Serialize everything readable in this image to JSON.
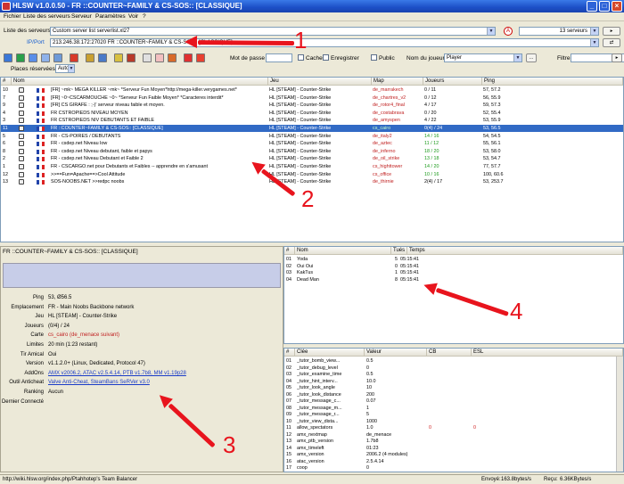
{
  "window": {
    "title": "HLSW v1.0.0.50 - FR ::COUNTER~FAMILY & CS-SOS:: [CLASSIQUE]"
  },
  "menu": [
    "Fichier",
    "Liste des serveurs",
    "Serveur",
    "Paramètres",
    "Voir",
    "?"
  ],
  "serverlist": {
    "label": "Liste des serveurs",
    "value": "Custom server list       serverlist.xl27",
    "count": "13 serveurs"
  },
  "ipport": {
    "label": "IP/Port",
    "value": "213.246.38.172:27020 FR ::COUNTER~FAMILY & CS-SOS:: [CLASSIQUE]"
  },
  "toolbar": {
    "password_label": "Mot de passe",
    "hide_label": "Cacher",
    "save_label": "Enregistrer",
    "public_label": "Public",
    "player_label": "Nom du joueur",
    "player_value": "Player",
    "filter_label": "Filtre",
    "reserved_label": "Places réservées",
    "reserved_value": "Auto"
  },
  "table": {
    "headers": [
      "#",
      "Nom",
      "Jeu",
      "Map",
      "Joueurs",
      "Ping"
    ],
    "rows": [
      {
        "n": "10",
        "name": "[FR] ~mk~ MEGA KILLER ~mk~ *Serveur Fun Moyen*http://mega-killer.verygames.net*",
        "game": "HL [STEAM] - Counter-Strike",
        "map": "de_marrakech",
        "players": "0 / 11",
        "ping": "57, 57.2"
      },
      {
        "n": "7",
        "name": "[FR] ~0~CSCARMOUCHE ~0~ *Serveur Fun Faible Moyen* *Caracteres interdit*",
        "game": "HL [STEAM] - Counter-Strike",
        "map": "de_chartres_v2",
        "players": "0 / 12",
        "ping": "56, 55.9"
      },
      {
        "n": "9",
        "name": "[FR] CS GIRAFE : ;-)' serveur niveau faible et moyen.",
        "game": "HL [STEAM] - Counter-Strike",
        "map": "de_rotor4_final",
        "players": "4 / 17",
        "ping": "59, 57.3"
      },
      {
        "n": "4",
        "name": "FR CSTROPIEDS NIVEAU MOYEN",
        "game": "HL [STEAM] - Counter-Strike",
        "map": "de_costabrava",
        "players": "0 / 20",
        "ping": "52, 55.4"
      },
      {
        "n": "3",
        "name": "FR CSTROPIEDS NIV DEBUTANTS ET FAIBLE",
        "game": "HL [STEAM] - Counter-Strike",
        "map": "de_amyspen",
        "players": "4 / 22",
        "ping": "53, 55.9"
      },
      {
        "n": "11",
        "name": "FR ::COUNTER~FAMILY & CS-SOS:: [CLASSIQUE]",
        "game": "HL [STEAM] - Counter-Strike",
        "map": "cs_cairo",
        "players": "0(4) / 24",
        "ping": "53, 56.5"
      },
      {
        "n": "5",
        "name": "FR - CS-POIRES / DEBUTANTS",
        "game": "HL [STEAM] - Counter-Strike",
        "map": "de_italy2",
        "players": "14 / 16",
        "ping": "54, 54.5"
      },
      {
        "n": "6",
        "name": "FR - csdep.net Niveau low",
        "game": "HL [STEAM] - Counter-Strike",
        "map": "de_aztec",
        "players": "11 / 12",
        "ping": "55, 56.1"
      },
      {
        "n": "8",
        "name": "FR - csdep.net Niveau debutant, faible et papys",
        "game": "HL [STEAM] - Counter-Strike",
        "map": "de_inferno",
        "players": "18 / 20",
        "ping": "53, 58.0"
      },
      {
        "n": "2",
        "name": "FR - csdep.net Niveau Debutant et Faible 2",
        "game": "HL [STEAM] - Counter-Strike",
        "map": "de_oil_strike",
        "players": "13 / 18",
        "ping": "53, 54.7"
      },
      {
        "n": "1",
        "name": "FR - CSCARGO.net pour Debutants et Faibles -- apprendre en s'amusant",
        "game": "HL [STEAM] - Counter-Strike",
        "map": "cs_highttower",
        "players": "14 / 20",
        "ping": "77, 57.7"
      },
      {
        "n": "12",
        "name": ">>==Fun=Apache==>Cool Attitude",
        "game": "HL [STEAM] - Counter-Strike",
        "map": "cs_office",
        "players": "10 / 16",
        "ping": "100, 60.6"
      },
      {
        "n": "13",
        "name": "SOS-NOOBS.NET >>redpc noobs",
        "game": "HL [STEAM] - Counter-Strike",
        "map": "de_thirnie",
        "players": "2(4) / 17",
        "ping": "53, 253.7"
      }
    ]
  },
  "info": {
    "title": "FR ::COUNTER~FAMILY & CS-SOS:: [CLASSIQUE]",
    "rows": [
      {
        "k": "Ping",
        "v": "53, Ø56.5"
      },
      {
        "k": "Emplacement",
        "v": "FR - Main Noobs Backbone network"
      },
      {
        "k": "Jeu",
        "v": "HL [STEAM] - Counter-Strike"
      },
      {
        "k": "Joueurs",
        "v": "(0/4) / 24"
      },
      {
        "k": "Carte",
        "v": "cs_cairo (de_menace suivant)"
      },
      {
        "k": "Limites",
        "v": "20 min (1:23 restant)"
      },
      {
        "k": "Tir Amical",
        "v": "Oui"
      },
      {
        "k": "Version",
        "v": "v1.1.2.0+ (Linux, Dedicated, Protocol 47)"
      },
      {
        "k": "AddOns",
        "v": "AMX v2006.2, ATAC v2.5.4.14, PTB v1.7b8, MM v1.19p28"
      },
      {
        "k": "Outil Anticheat",
        "v": "Valve Anti-Cheat, SteamBans SeRVer v3.0"
      },
      {
        "k": "Ranking",
        "v": "Aucun"
      },
      {
        "k": "Dernier Connecté",
        "v": ""
      }
    ]
  },
  "players": {
    "headers": [
      "#",
      "Nom",
      "Tués",
      "Temps"
    ],
    "rows": [
      {
        "n": "01",
        "name": "Yoda",
        "kills": "5",
        "time": "05:15:41"
      },
      {
        "n": "02",
        "name": "Oui Oui",
        "kills": "0",
        "time": "05:15:41"
      },
      {
        "n": "03",
        "name": "KakTus",
        "kills": "1",
        "time": "05:15:41"
      },
      {
        "n": "04",
        "name": "Dead Man",
        "kills": "8",
        "time": "05:15:41"
      }
    ]
  },
  "cvars": {
    "headers": [
      "#",
      "Clée",
      "Valeur",
      "CB",
      "ESL"
    ],
    "rows": [
      {
        "n": "01",
        "key": "_tutor_bomb_view...",
        "val": "0.5",
        "cb": "",
        "esl": ""
      },
      {
        "n": "02",
        "key": "_tutor_debug_level",
        "val": "0",
        "cb": "",
        "esl": ""
      },
      {
        "n": "03",
        "key": "_tutor_examine_time",
        "val": "0.5",
        "cb": "",
        "esl": ""
      },
      {
        "n": "04",
        "key": "_tutor_hint_interv...",
        "val": "10.0",
        "cb": "",
        "esl": ""
      },
      {
        "n": "05",
        "key": "_tutor_look_angle",
        "val": "10",
        "cb": "",
        "esl": ""
      },
      {
        "n": "06",
        "key": "_tutor_look_distance",
        "val": "200",
        "cb": "",
        "esl": ""
      },
      {
        "n": "07",
        "key": "_tutor_message_c...",
        "val": "0.07",
        "cb": "",
        "esl": ""
      },
      {
        "n": "08",
        "key": "_tutor_message_m...",
        "val": "1",
        "cb": "",
        "esl": ""
      },
      {
        "n": "09",
        "key": "_tutor_message_r...",
        "val": "5",
        "cb": "",
        "esl": ""
      },
      {
        "n": "10",
        "key": "_tutor_view_dista...",
        "val": "1000",
        "cb": "",
        "esl": ""
      },
      {
        "n": "11",
        "key": "allow_spectators",
        "val": "1.0",
        "cb": "0",
        "esl": "0"
      },
      {
        "n": "12",
        "key": "amx_nextmap",
        "val": "de_menace",
        "cb": "",
        "esl": ""
      },
      {
        "n": "13",
        "key": "amx_ptb_version",
        "val": "1.7b8",
        "cb": "",
        "esl": ""
      },
      {
        "n": "14",
        "key": "amx_timeleft",
        "val": "01:23",
        "cb": "",
        "esl": ""
      },
      {
        "n": "15",
        "key": "amx_version",
        "val": "2006.2 (4 modules)",
        "cb": "",
        "esl": ""
      },
      {
        "n": "16",
        "key": "atac_version",
        "val": "2.5.4.14",
        "cb": "",
        "esl": ""
      },
      {
        "n": "17",
        "key": "coop",
        "val": "0",
        "cb": "",
        "esl": ""
      }
    ]
  },
  "status": {
    "url": "http://wiki.hlsw.org/index.php/Ptahhotep's Team Balancer",
    "sent_label": "Envoyé:",
    "sent_value": "163.8bytes/s",
    "recv_label": "Reçu:",
    "recv_value": "6.36KBytes/s"
  },
  "annotations": [
    "1",
    "2",
    "3",
    "4"
  ],
  "colors": {
    "titlebar": "#1c4fc7",
    "selection": "#316ac5",
    "annotation": "#e8141d",
    "map_text": "#c02020"
  }
}
